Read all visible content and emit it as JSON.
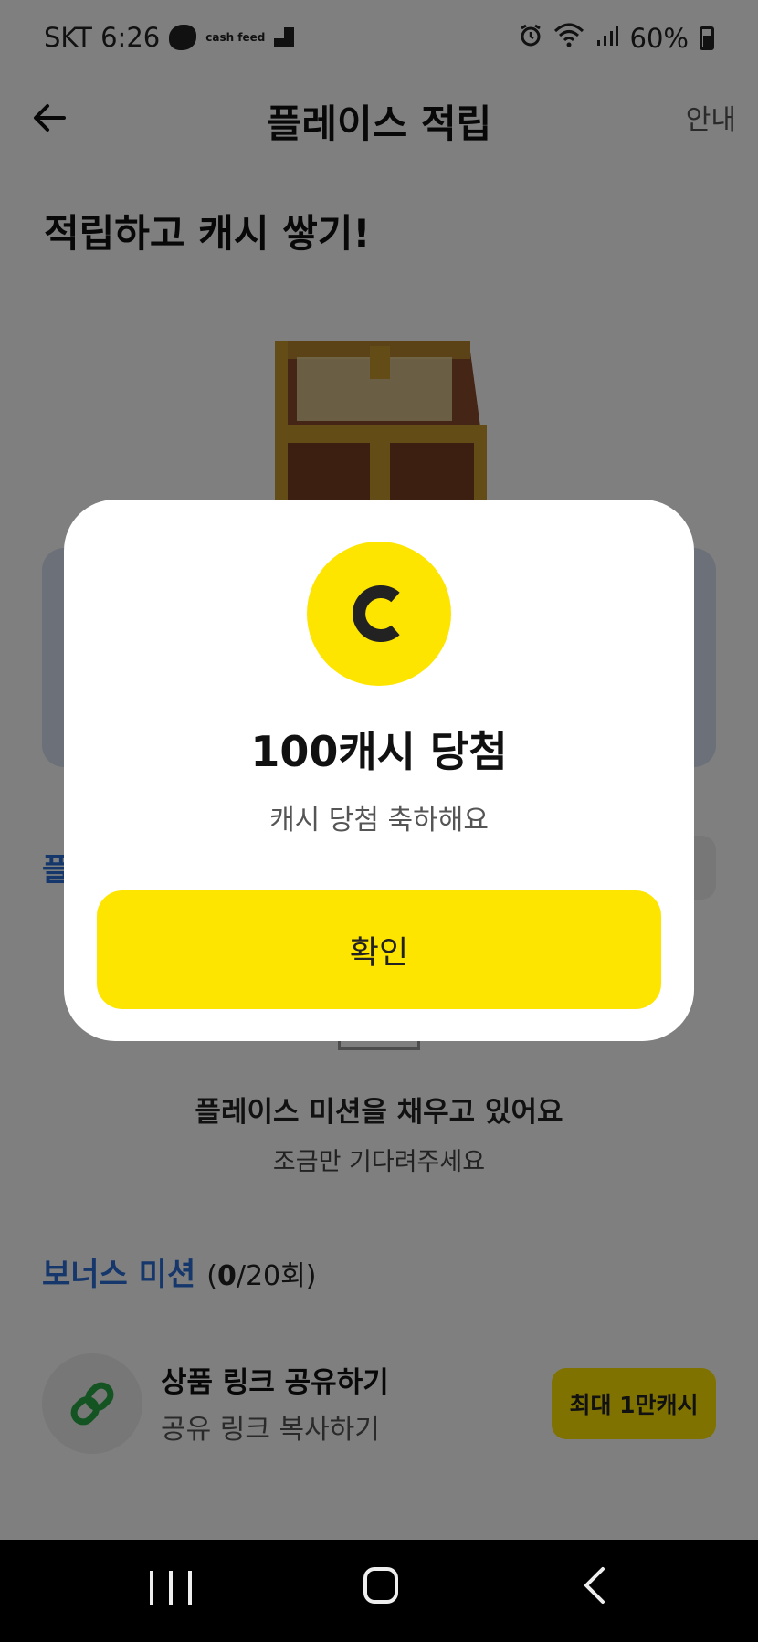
{
  "status_bar": {
    "carrier_time": "SKT 6:26",
    "cashfeed_text": "cash feed",
    "battery": "60%"
  },
  "header": {
    "title": "플레이스 적립",
    "guide_link": "안내"
  },
  "hero": {
    "title": "적립하고 캐시 쌓기!"
  },
  "progress": {
    "title": "플레이스 미션을 채우고 있어요",
    "subtitle": "조금만 기다려주세요"
  },
  "bonus": {
    "title": "보너스 미션",
    "count_open": "(",
    "count_done": "0",
    "count_total": "/20회)"
  },
  "mission": {
    "title": "상품 링크 공유하기",
    "subtitle": "공유 링크 복사하기",
    "badge": "최대 1만캐시"
  },
  "modal": {
    "title": "100캐시 당첨",
    "subtitle": "캐시 당첨 축하해요",
    "confirm_label": "확인"
  },
  "colors": {
    "accent_yellow": "#fee500",
    "accent_blue": "#2a6fd6",
    "link_green": "#27a844"
  }
}
